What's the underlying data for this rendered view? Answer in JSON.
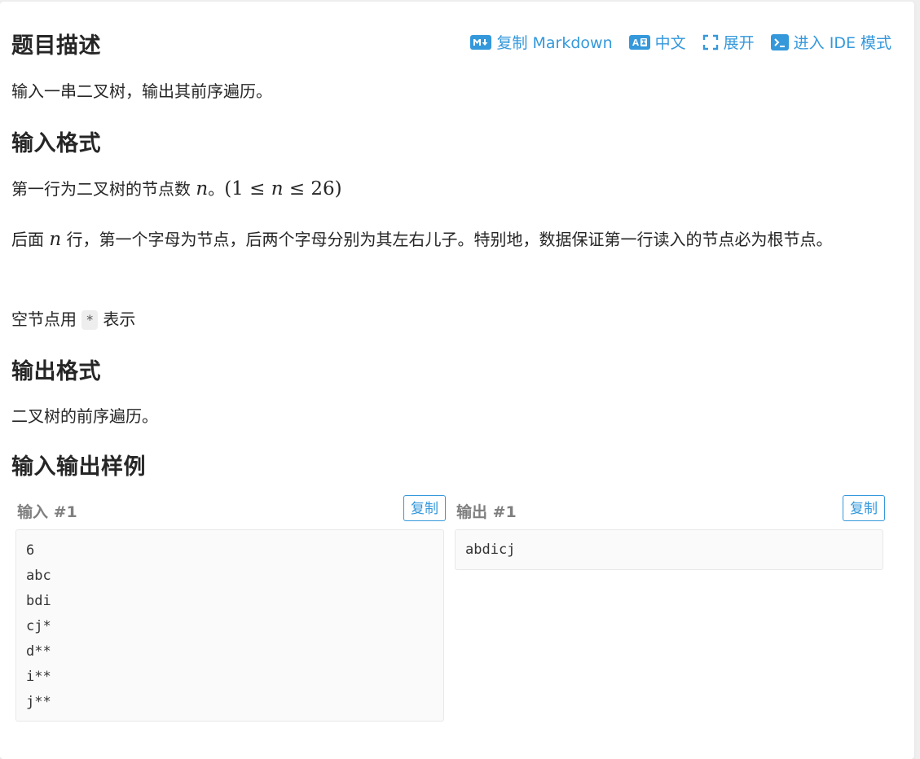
{
  "header": {
    "title": "题目描述",
    "toolbar": {
      "copy_markdown": "复制 Markdown",
      "language": "中文",
      "expand": "展开",
      "ide_mode": "进入 IDE 模式"
    }
  },
  "description": {
    "text": "输入一串二叉树，输出其前序遍历。"
  },
  "input_format": {
    "heading": "输入格式",
    "line1_prefix": "第一行为二叉树的节点数 ",
    "line1_var": "n",
    "line1_sep": "。",
    "line1_math_open": "(1 ≤ ",
    "line1_math_var": "n",
    "line1_math_close": " ≤ 26)",
    "line2_prefix": "后面 ",
    "line2_var": "n",
    "line2_rest": " 行，第一个字母为节点，后两个字母分别为其左右儿子。特别地，数据保证第一行读入的节点必为根节点。",
    "line3_prefix": "空节点用 ",
    "line3_code": "*",
    "line3_suffix": " 表示"
  },
  "output_format": {
    "heading": "输出格式",
    "text": "二叉树的前序遍历。"
  },
  "samples": {
    "heading": "输入输出样例",
    "input": {
      "label": "输入 #1",
      "copy_label": "复制",
      "lines": [
        "6",
        "abc",
        "bdi",
        "cj*",
        "d**",
        "i**",
        "j**"
      ]
    },
    "output": {
      "label": "输出 #1",
      "copy_label": "复制",
      "lines": [
        "abdicj"
      ]
    }
  },
  "colors": {
    "accent": "#3498db",
    "text": "#262626",
    "muted_label": "#7f7f7f"
  }
}
